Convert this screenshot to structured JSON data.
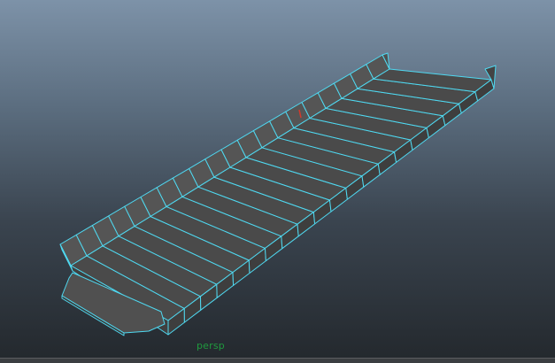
{
  "viewport": {
    "camera_name": "persp",
    "camera_label_color": "#1f9a3e",
    "wireframe_color": "#4fd8f0",
    "face_color": "#4c4c4c",
    "pivot_marker_color": "#d23a2c"
  },
  "model": {
    "floor_segments": 20,
    "wall_segments": 20
  }
}
